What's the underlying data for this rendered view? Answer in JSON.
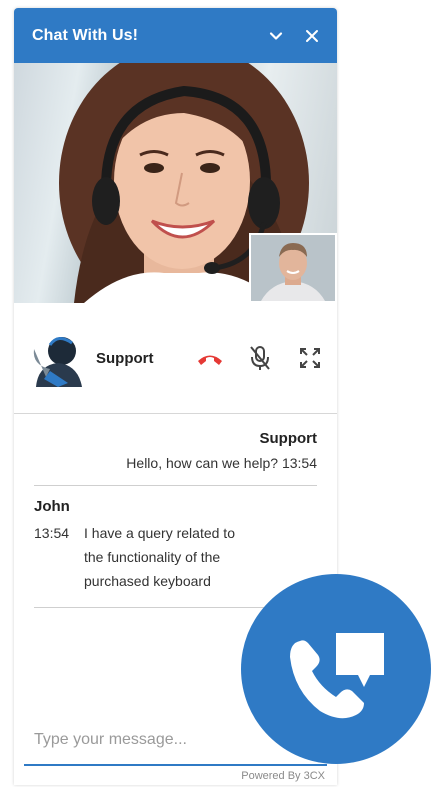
{
  "header": {
    "title": "Chat With Us!",
    "minimize_icon": "chevron-down-icon",
    "close_icon": "close-icon"
  },
  "call": {
    "agent_name": "Support",
    "hangup_icon": "phone-hangup-icon",
    "mute_icon": "mic-off-icon",
    "fullscreen_icon": "expand-icon",
    "hangup_color": "#e53935"
  },
  "messages": [
    {
      "sender": "Support",
      "text": "Hello, how can we help?",
      "time": "13:54"
    },
    {
      "sender": "John",
      "time": "13:54",
      "text": "I have a query related to the functionality of the purchased keyboard"
    }
  ],
  "input": {
    "placeholder": "Type your message..."
  },
  "footer": {
    "powered_by": "Powered By 3CX"
  },
  "colors": {
    "brand": "#2f7ac5"
  },
  "fab": {
    "icon": "phone-chat-icon"
  }
}
